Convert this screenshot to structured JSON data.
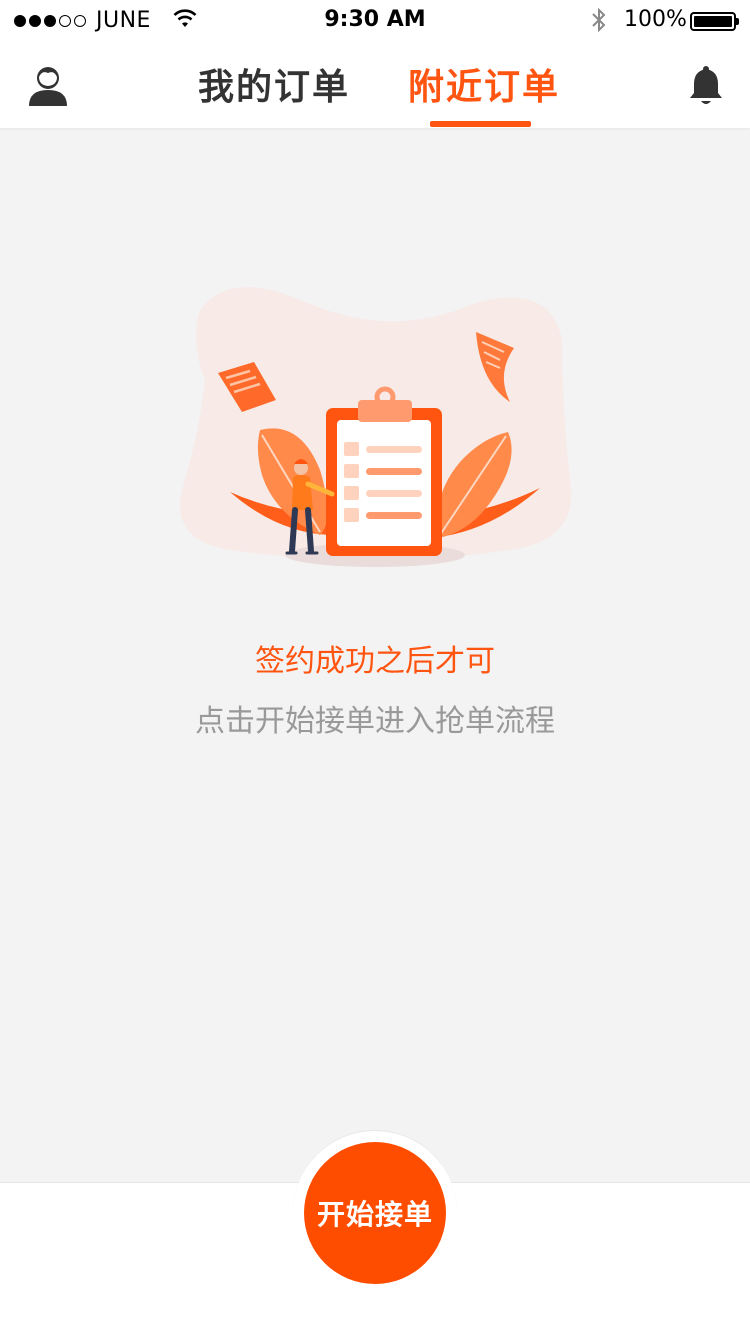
{
  "status_bar": {
    "carrier": "JUNE",
    "time": "9:30 AM",
    "battery": "100%",
    "signal_bars_filled": 3,
    "signal_bars_total": 5
  },
  "nav": {
    "tabs": [
      {
        "label": "我的订单",
        "active": false
      },
      {
        "label": "附近订单",
        "active": true
      }
    ],
    "left_icon": "profile-icon",
    "right_icon": "bell-icon"
  },
  "empty_state": {
    "title": "签约成功之后才可",
    "subtitle": "点击开始接单进入抢单流程",
    "illustration": "clipboard-illustration"
  },
  "action": {
    "start_label": "开始接单"
  },
  "colors": {
    "accent": "#ff5511",
    "button": "#ff4d00",
    "background": "#f3f3f3",
    "muted_text": "#999999"
  }
}
